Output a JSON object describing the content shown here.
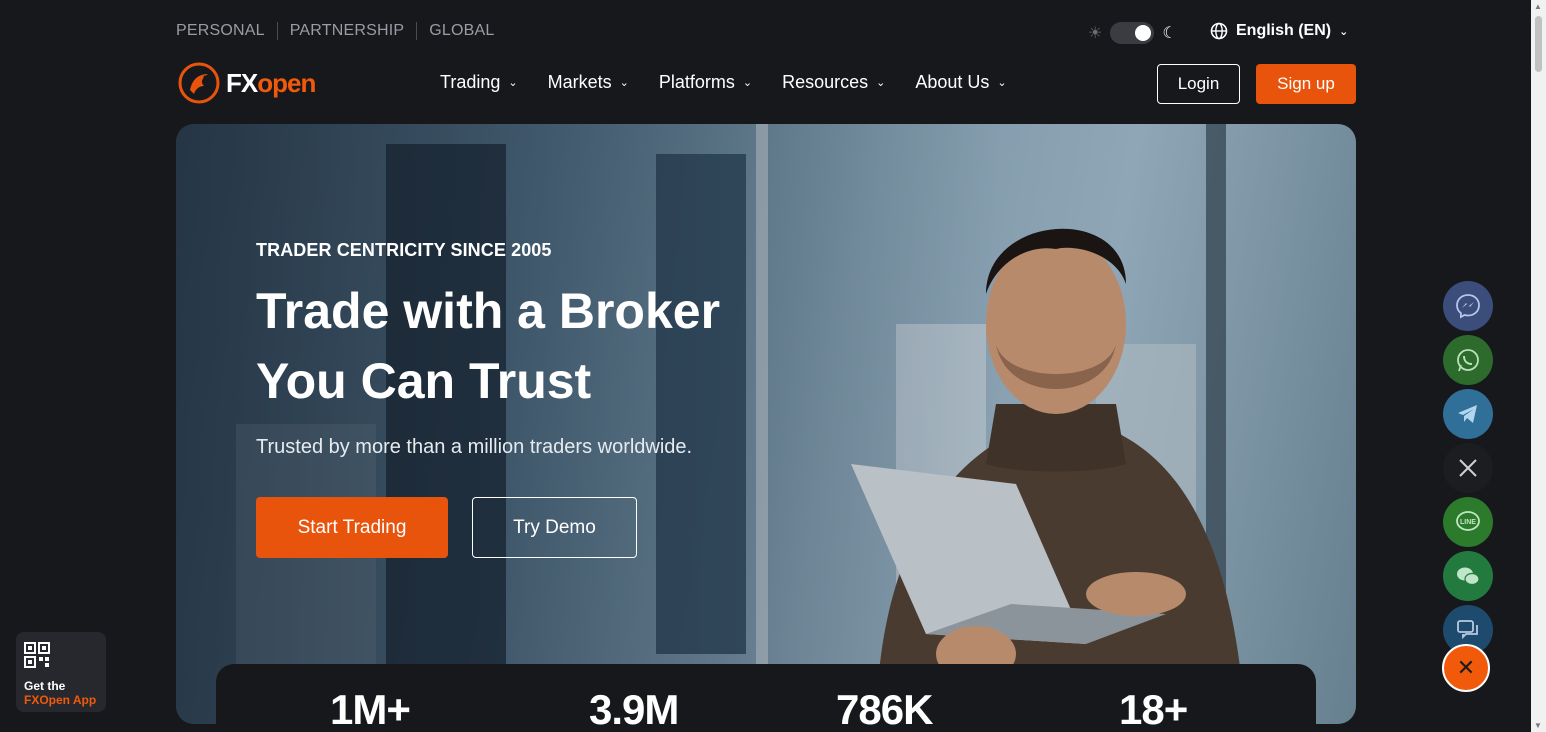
{
  "topbar": {
    "links": [
      "PERSONAL",
      "PARTNERSHIP",
      "GLOBAL"
    ]
  },
  "theme": {
    "mode": "dark"
  },
  "language": {
    "label": "English (EN)"
  },
  "brand": {
    "fx": "FX",
    "open": "open",
    "accent": "#e8540c"
  },
  "nav": {
    "items": [
      "Trading",
      "Markets",
      "Platforms",
      "Resources",
      "About Us"
    ]
  },
  "auth": {
    "login": "Login",
    "signup": "Sign up"
  },
  "hero": {
    "eyebrow": "TRADER CENTRICITY SINCE 2005",
    "headline_1": "Trade with a Broker",
    "headline_2": "You Can Trust",
    "subline": "Trusted by more than a million traders worldwide.",
    "start_label": "Start Trading",
    "demo_label": "Try Demo"
  },
  "stats": [
    "1M+",
    "3.9M",
    "786K",
    "18+"
  ],
  "app_promo": {
    "line1": "Get the",
    "line2": "FXOpen App"
  },
  "social": [
    "messenger-icon",
    "whatsapp-icon",
    "telegram-icon",
    "x-icon",
    "line-icon",
    "wechat-icon",
    "chat-icon"
  ]
}
